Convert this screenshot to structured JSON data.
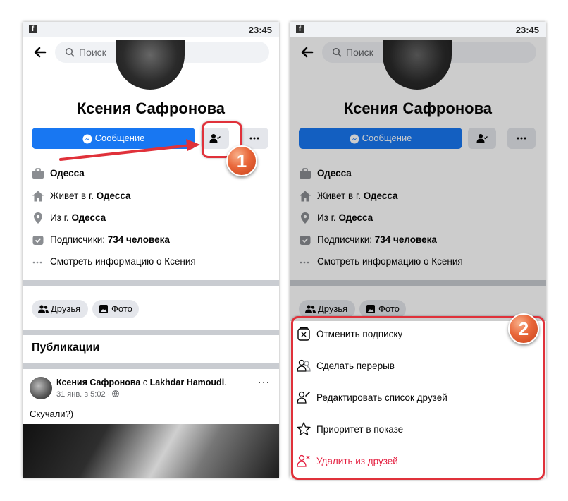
{
  "status_bar": {
    "app_glyph": "f",
    "time": "23:45"
  },
  "search": {
    "placeholder": "Поиск"
  },
  "profile": {
    "name": "Ксения Сафронова",
    "message_button": "Сообщение",
    "more_glyph": "···"
  },
  "info": {
    "work": "Одесса",
    "lives_prefix": "Живет в г.",
    "lives_city": "Одесса",
    "from_prefix": "Из г.",
    "from_city": "Одесса",
    "followers_prefix": "Подписчики:",
    "followers_value": "734 человека",
    "see_info": "Смотреть информацию о Ксения"
  },
  "chips": {
    "friends": "Друзья",
    "photos": "Фото"
  },
  "publications_title": "Публикации",
  "post": {
    "author": "Ксения Сафронова",
    "with": "с",
    "tagged": "Lakhdar Hamoudi",
    "period": ".",
    "date": "31 янв. в 5:02 ·",
    "text": "Скучали?)",
    "more_glyph": "···"
  },
  "menu": [
    {
      "label": "Отменить подписку",
      "icon": "unfollow-icon"
    },
    {
      "label": "Сделать перерыв",
      "icon": "take-break-icon"
    },
    {
      "label": "Редактировать список друзей",
      "icon": "edit-friend-list-icon"
    },
    {
      "label": "Приоритет в показе",
      "icon": "star-icon"
    },
    {
      "label": "Удалить из друзей",
      "icon": "unfriend-icon"
    }
  ],
  "annotations": {
    "step1": "1",
    "step2": "2"
  },
  "colors": {
    "accent": "#1877f2",
    "danger": "#e41e3f",
    "callout": "#e0313a"
  }
}
